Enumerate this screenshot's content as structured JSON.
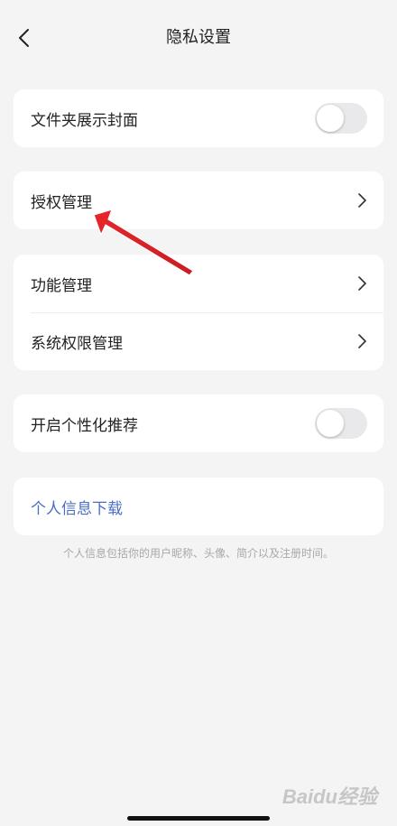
{
  "header": {
    "title": "隐私设置",
    "back_icon": "chevron-left-icon"
  },
  "sections": [
    {
      "rows": [
        {
          "label": "文件夹展示封面",
          "control": "toggle",
          "toggle_on": false
        }
      ]
    },
    {
      "rows": [
        {
          "label": "授权管理",
          "control": "chevron"
        }
      ]
    },
    {
      "rows": [
        {
          "label": "功能管理",
          "control": "chevron"
        },
        {
          "label": "系统权限管理",
          "control": "chevron"
        }
      ]
    },
    {
      "rows": [
        {
          "label": "开启个性化推荐",
          "control": "toggle",
          "toggle_on": false
        }
      ]
    },
    {
      "rows": [
        {
          "label": "个人信息下载",
          "control": "link"
        }
      ]
    }
  ],
  "footnote": "个人信息包括你的用户昵称、头像、简介以及注册时间。",
  "annotation": {
    "type": "red-arrow",
    "points_to": "授权管理"
  },
  "watermark": "Baidu经验",
  "colors": {
    "background": "#f4f4f4",
    "card": "#ffffff",
    "link": "#4a6ec4",
    "toggle_off": "#e9e9eb",
    "annotation_arrow": "#e8262b"
  }
}
